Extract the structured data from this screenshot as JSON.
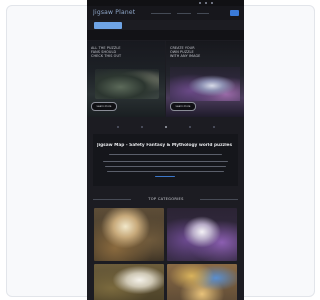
{
  "header": {
    "logo_text": "Jigsaw Planet"
  },
  "promos": [
    {
      "text": "All the puzzle fans should check this out",
      "button_label": "Learn more"
    },
    {
      "text": "Create your own puzzle with any image",
      "button_label": "Learn more"
    }
  ],
  "info": {
    "title": "Jigsaw Map - Safety Fantasy & Mythology world puzzles 1"
  },
  "categories": {
    "title": "TOP CATEGORIES"
  },
  "colors": {
    "background": "#1c1c22",
    "accent": "#3a7ad8",
    "chip": "#6fa4e6"
  }
}
